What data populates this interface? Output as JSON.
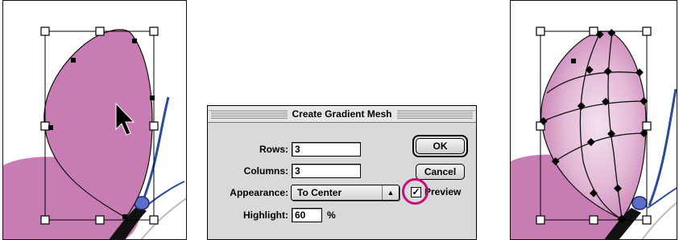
{
  "dialog": {
    "title": "Create Gradient Mesh",
    "rows_label": "Rows:",
    "rows_value": "3",
    "columns_label": "Columns:",
    "columns_value": "3",
    "appearance_label": "Appearance:",
    "appearance_value": "To Center",
    "highlight_label": "Highlight:",
    "highlight_value": "60",
    "highlight_unit": "%",
    "ok_label": "OK",
    "cancel_label": "Cancel",
    "preview_label": "Preview",
    "preview_checked": true
  },
  "icons": {
    "popup_arrows": "up-down-arrows-icon",
    "cursor": "arrow-cursor-icon",
    "checkbox_mark": "checkmark-icon"
  },
  "colors": {
    "butterfly_wing": "#c77db3",
    "mesh_highlight": "#f1dcea",
    "annotation_circle": "#c2127a",
    "dialog_bg": "#d9d9d9",
    "antenna_blue": "#2b4aa0"
  }
}
